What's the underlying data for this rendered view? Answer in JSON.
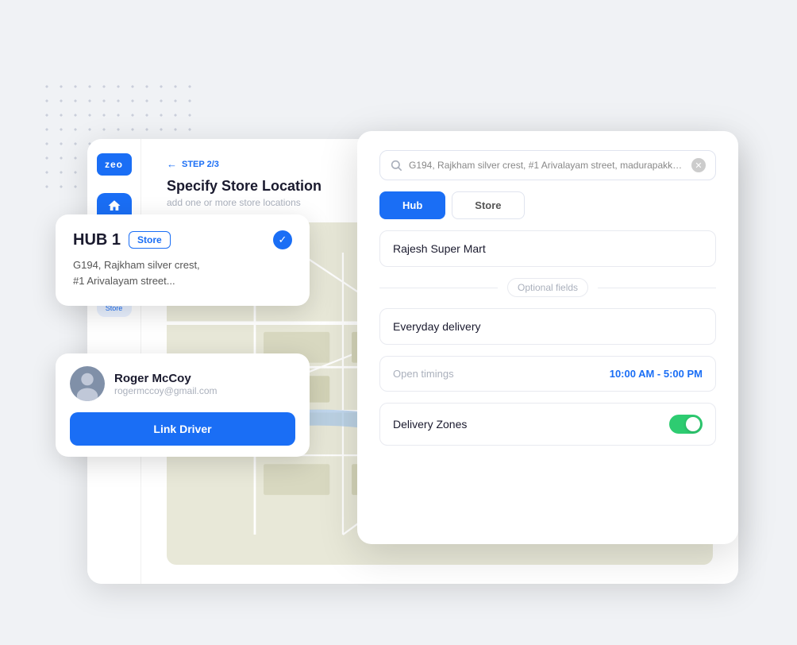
{
  "app": {
    "logo": "zeo",
    "background_dots": true
  },
  "sidebar": {
    "items": [
      {
        "id": "home",
        "label": "Home",
        "active": true
      },
      {
        "id": "store",
        "label": "Store",
        "active": false
      }
    ]
  },
  "step_panel": {
    "step": "STEP 2/3",
    "title": "Specify Store Location",
    "subtitle": "add one or more store locations"
  },
  "right_panel": {
    "search": {
      "placeholder": "G194, Rajkham silver crest, #1 Arivalayam street, madurapakkam,...",
      "value": "G194, Rajkham silver crest, #1 Arivalayam street, madurapakkam,..."
    },
    "type_toggle": {
      "options": [
        "Hub",
        "Store"
      ],
      "active": "Hub"
    },
    "store_name": "Rajesh Super Mart",
    "optional_label": "Optional fields",
    "description": "Everyday delivery",
    "timings": {
      "label": "Open timings",
      "value": "10:00 AM - 5:00 PM"
    },
    "delivery_zones": {
      "label": "Delivery Zones",
      "enabled": true
    }
  },
  "hub_card": {
    "title": "HUB 1",
    "badge": "Store",
    "address": "G194, Rajkham silver crest,\n#1 Arivalayam street...",
    "checked": true
  },
  "driver_card": {
    "name": "Roger McCoy",
    "email": "rogermccoy@gmail.com",
    "button_label": "Link Driver"
  }
}
